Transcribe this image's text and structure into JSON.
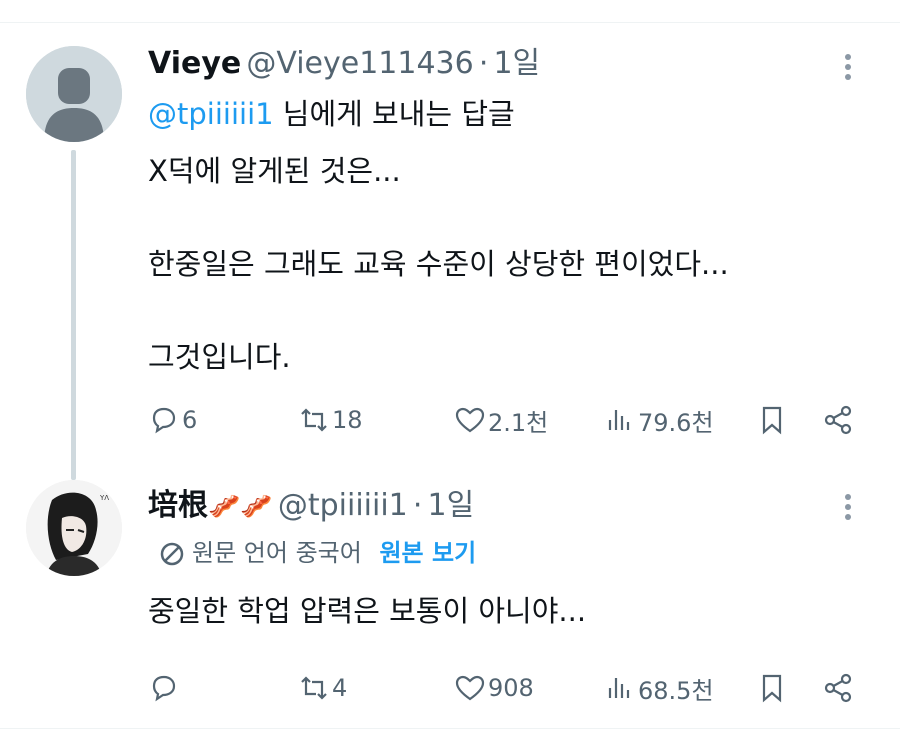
{
  "post1": {
    "display_name": "Vieye",
    "handle": "@Vieye111436",
    "dot": "·",
    "time": "1일",
    "reply_to_handle": "@tpiiiiii1",
    "reply_to_suffix": " 님에게 보내는 답글",
    "lines": [
      "X덕에 알게된 것은...",
      "한중일은 그래도 교육 수준이 상당한 편이었다...",
      "그것입니다."
    ],
    "actions": {
      "replies": "6",
      "reposts": "18",
      "likes": "2.1천",
      "views": "79.6천"
    }
  },
  "post2": {
    "display_name": "培根",
    "name_emoji": "🥓🥓",
    "handle": "@tpiiiiii1",
    "dot": "·",
    "time": "1일",
    "translate_label": "원문 언어 중국어",
    "show_original": "원본 보기",
    "lines": [
      "중일한 학업 압력은 보통이 아니야..."
    ],
    "actions": {
      "replies": "",
      "reposts": "4",
      "likes": "908",
      "views": "68.5천"
    }
  },
  "icons": [
    "reply-icon",
    "repost-icon",
    "like-icon",
    "views-icon",
    "bookmark-icon",
    "share-icon",
    "more-icon",
    "translate-icon"
  ],
  "colors": {
    "link": "#1d9bf0",
    "muted": "#536471",
    "text": "#0f1419"
  }
}
